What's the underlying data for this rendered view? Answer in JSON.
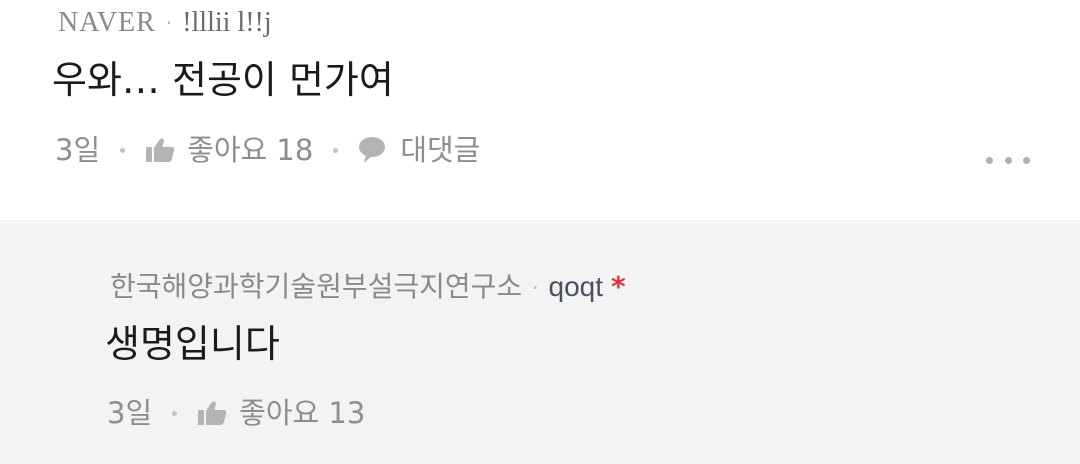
{
  "comments": [
    {
      "source": "NAVER",
      "author": "!lllii l!!j",
      "text": "우와… 전공이 먼가여",
      "time": "3일",
      "like_label": "좋아요 18",
      "reply_label": "대댓글"
    }
  ],
  "reply": {
    "source": "한국해양과학기술원부설극지연구소",
    "author": "qoqt",
    "badge": "*",
    "text": "생명입니다",
    "time": "3일",
    "like_label": "좋아요 13"
  },
  "icons": {
    "like": "thumbs-up-icon",
    "reply": "speech-bubble-icon",
    "more": "more-horizontal-icon"
  },
  "colors": {
    "reply_background": "#f3f3f3",
    "badge": "#e0323b",
    "meta_text": "#8a8a8a"
  }
}
